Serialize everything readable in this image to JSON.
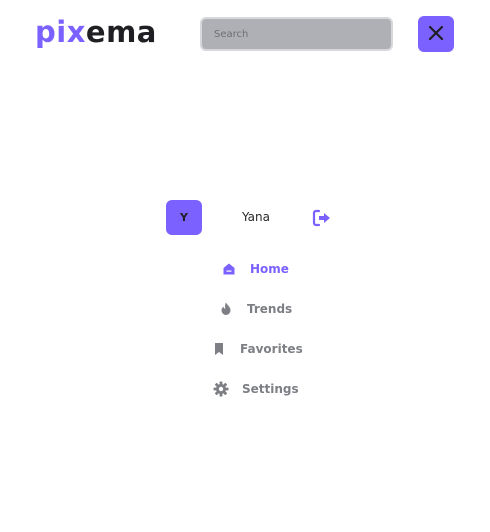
{
  "brand": {
    "logo_part1": "pix",
    "logo_part2": "ema"
  },
  "header": {
    "search_placeholder": "Search",
    "close_icon": "close-icon"
  },
  "user": {
    "avatar_initial": "Y",
    "name": "Yana",
    "logout_icon": "logout-icon"
  },
  "menu": {
    "items": [
      {
        "label": "Home",
        "icon": "home-icon",
        "active": true
      },
      {
        "label": "Trends",
        "icon": "flame-icon",
        "active": false
      },
      {
        "label": "Favorites",
        "icon": "bookmark-icon",
        "active": false
      },
      {
        "label": "Settings",
        "icon": "gear-icon",
        "active": false
      }
    ]
  },
  "colors": {
    "accent": "#7b61ff",
    "text_dark": "#1f1f23",
    "muted": "#7d7f85",
    "search_bg": "#aeb0b5"
  }
}
